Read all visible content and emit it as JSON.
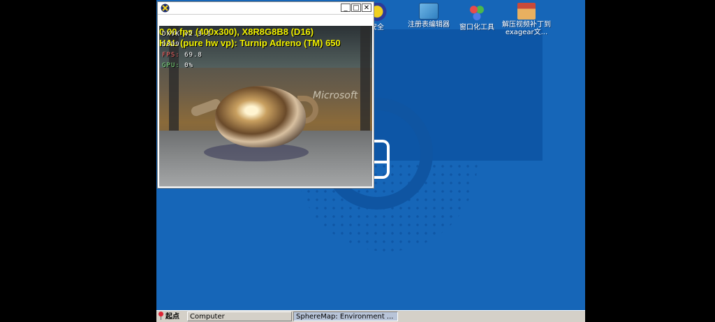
{
  "desktop": {
    "icons": [
      {
        "label": "安全",
        "icon": "install-icon"
      },
      {
        "label": "注册表编辑器",
        "icon": "registry-editor-icon"
      },
      {
        "label": "窗口化工具",
        "icon": "window-tool-icon"
      },
      {
        "label": "解压视频补丁到exagear文...",
        "icon": "package-icon"
      }
    ],
    "wallpaper_logo": "Microsoft"
  },
  "window": {
    "controls": {
      "minimize": "_",
      "maximize": "□",
      "close": "✕"
    },
    "hud": {
      "line1": "0.00 fps (400x300), X8R8G8B8 (D16)",
      "line2": "HAL (pure hw vp): Turnip Adreno (TM) 650"
    },
    "dxvk": {
      "version": "DXVK v2.3.1",
      "api": "D3D9",
      "fps_label": "FPS:",
      "fps_value": "69.8",
      "gpu_label": "GPU:",
      "gpu_value": "0%"
    }
  },
  "taskbar": {
    "start_label": "起点",
    "tasks": [
      {
        "label": "Computer",
        "active": false
      },
      {
        "label": "SphereMap: Environment ...",
        "active": true
      }
    ]
  },
  "colors": {
    "desktop": "#1666b8",
    "taskbar": "#d4d0c8",
    "hud_text": "#f0f000"
  }
}
